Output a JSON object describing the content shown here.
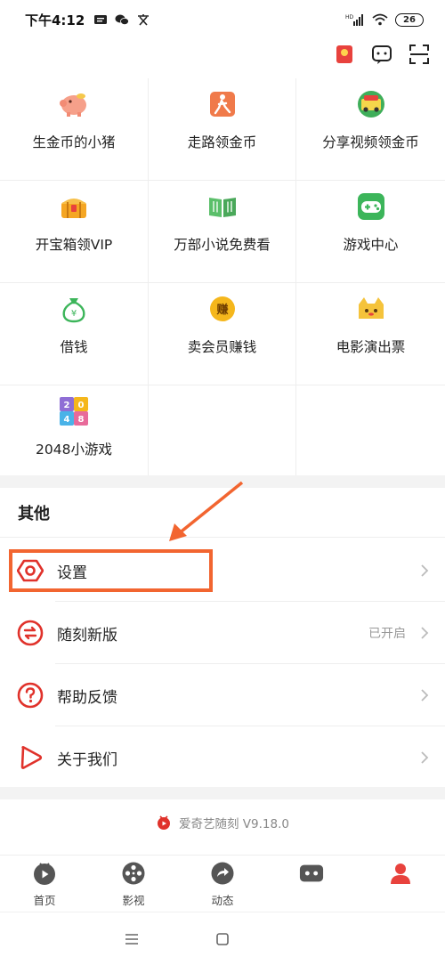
{
  "status_bar": {
    "time": "下午4:12",
    "battery": "26",
    "network": "HD"
  },
  "grid": {
    "items": [
      {
        "label": "生金币的小猪",
        "icon": "piggy-icon"
      },
      {
        "label": "走路领金币",
        "icon": "walking-icon"
      },
      {
        "label": "分享视频领金币",
        "icon": "share-video-icon"
      },
      {
        "label": "开宝箱领VIP",
        "icon": "treasure-chest-icon"
      },
      {
        "label": "万部小说免费看",
        "icon": "book-icon"
      },
      {
        "label": "游戏中心",
        "icon": "gamepad-icon"
      },
      {
        "label": "借钱",
        "icon": "money-bag-icon"
      },
      {
        "label": "卖会员赚钱",
        "icon": "earn-coin-icon"
      },
      {
        "label": "电影演出票",
        "icon": "movie-ticket-icon"
      },
      {
        "label": "2048小游戏",
        "icon": "game-2048-icon"
      }
    ],
    "coin_label": "赚",
    "bag_label": "¥",
    "tiles": [
      "2",
      "0",
      "4",
      "8"
    ]
  },
  "other_section": {
    "title": "其他",
    "rows": [
      {
        "label": "设置",
        "value": "",
        "icon": "settings-icon"
      },
      {
        "label": "随刻新版",
        "value": "已开启",
        "icon": "switch-icon"
      },
      {
        "label": "帮助反馈",
        "value": "",
        "icon": "help-icon"
      },
      {
        "label": "关于我们",
        "value": "",
        "icon": "play-icon"
      }
    ]
  },
  "version": "爱奇艺随刻 V9.18.0",
  "bottom_nav": [
    {
      "label": "首页",
      "icon": "home-icon"
    },
    {
      "label": "影视",
      "icon": "film-reel-icon"
    },
    {
      "label": "动态",
      "icon": "feed-icon"
    },
    {
      "label": "",
      "icon": "game-icon"
    },
    {
      "label": "",
      "icon": "profile-icon"
    }
  ],
  "colors": {
    "accent": "#e0322b",
    "highlight": "#f26530",
    "nav_icon": "#555555",
    "profile_active": "#e8423d"
  }
}
